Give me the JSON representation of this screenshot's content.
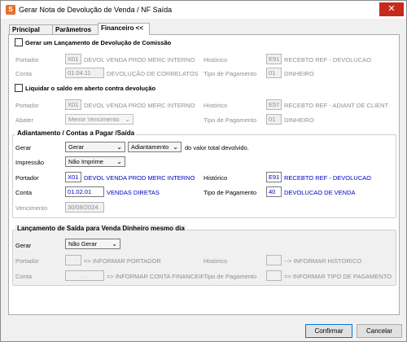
{
  "window": {
    "title": "Gerar Nota de Devolução de Venda / NF Saída",
    "close_glyph": "✕",
    "app_icon": "app-icon"
  },
  "tabs": [
    {
      "label": "Principal"
    },
    {
      "label": "Parâmetros"
    },
    {
      "label": "Financeiro <<"
    }
  ],
  "comissao": {
    "checkbox_label": "Gerar um Lançamento de Devolução de Comissão",
    "portador_label": "Portador",
    "portador_code": "X01",
    "portador_name": "DEVOL VENDA PROD MERC INTERNO",
    "historico_label": "Histórico",
    "historico_code": "E91",
    "historico_name": "RECEBTO REF - DEVOLUCAO",
    "conta_label": "Conta",
    "conta_value": "01.04.11",
    "conta_name": "DEVOLUÇÃO DE CORRELATOS",
    "tipo_label": "Tipo de Pagamento",
    "tipo_code": "01",
    "tipo_name": "DINHEIRO"
  },
  "liquidar": {
    "checkbox_label": "Liquidar o saldo em aberto contra devolução",
    "portador_label": "Portador",
    "portador_code": "X01",
    "portador_name": "DEVOL VENDA PROD MERC INTERNO",
    "historico_label": "Histórico",
    "historico_code": "E57",
    "historico_name": "RECEBTO REF - ADIANT DE CLIENT",
    "abater_label": "Abater",
    "abater_value": "Menor Vencimento",
    "tipo_label": "Tipo de Pagamento",
    "tipo_code": "01",
    "tipo_name": "DINHEIRO"
  },
  "adiantamento": {
    "group_title": "Adiantamento / Contas a Pagar /Saída",
    "gerar_label": "Gerar",
    "gerar_value": "Gerar",
    "tipo_value": "Adiantamento",
    "suffix": "do valor total devolvido.",
    "impressao_label": "Impressão",
    "impressao_value": "Não Imprime",
    "portador_label": "Portador",
    "portador_code": "X01",
    "portador_name": "DEVOL VENDA PROD MERC INTERNO",
    "historico_label": "Histórico",
    "historico_code": "E91",
    "historico_name": "RECEBTO REF - DEVOLUCAO",
    "conta_label": "Conta",
    "conta_value": "01.02.01",
    "conta_name": "VENDAS DIRETAS",
    "tipo_label": "Tipo de Pagamento",
    "tipo_code": "40",
    "tipo_name": "DEVOLUCAO DE VENDA",
    "vencimento_label": "Vencimento",
    "vencimento_value": "30/08/2024"
  },
  "saida_dinheiro": {
    "group_title": "Lançamento de Saída para Venda Dinheiro mesmo dia",
    "gerar_label": "Gerar",
    "gerar_value": "Não Gerar",
    "portador_label": "Portador",
    "portador_code": "",
    "portador_name": "=> INFORMAR PORTADOR",
    "historico_label": "Histórico",
    "historico_code": "",
    "historico_name": "--> INFORMAR HISTORICO",
    "conta_label": "Conta",
    "conta_value": ". .",
    "conta_name": "=> INFORMAR CONTA FINANCEIRA",
    "tipo_label": "Tipo de Pagamento",
    "tipo_code": "",
    "tipo_name": "=> INFORMAR TIPO DE PAGAMENTO"
  },
  "buttons": {
    "confirm_label": "Confirmar",
    "cancel_label": "Cancelar"
  },
  "colors": {
    "accent": "#0078d7",
    "link_blue": "#0000c0",
    "close_red": "#c42b1c"
  }
}
